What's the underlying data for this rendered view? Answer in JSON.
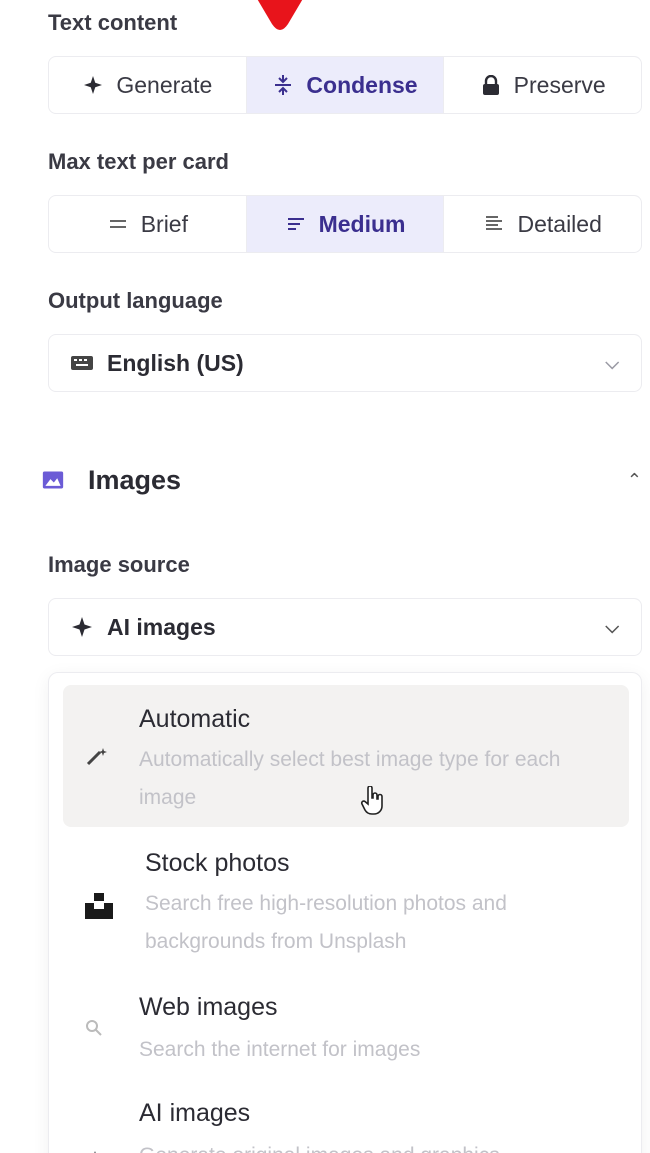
{
  "text_content": {
    "label": "Text content",
    "options": [
      {
        "label": "Generate",
        "icon": "sparkle-icon"
      },
      {
        "label": "Condense",
        "icon": "condense-icon",
        "active": true
      },
      {
        "label": "Preserve",
        "icon": "lock-icon"
      }
    ]
  },
  "max_text": {
    "label": "Max text per card",
    "options": [
      {
        "label": "Brief",
        "icon": "lines-brief-icon"
      },
      {
        "label": "Medium",
        "icon": "lines-medium-icon",
        "active": true
      },
      {
        "label": "Detailed",
        "icon": "lines-detailed-icon"
      }
    ]
  },
  "output_language": {
    "label": "Output language",
    "value": "English (US)",
    "icon": "keyboard-icon"
  },
  "images_section": {
    "title": "Images",
    "icon": "image-icon",
    "accent": "#6b5bd6"
  },
  "image_source": {
    "label": "Image source",
    "value": "AI images"
  },
  "menu": {
    "items": [
      {
        "title": "Automatic",
        "desc": "Automatically select best image type for each image",
        "icon": "magic-wand-icon"
      },
      {
        "title": "Stock photos",
        "desc": "Search free high-resolution photos and backgrounds from Unsplash",
        "icon": "unsplash-icon"
      },
      {
        "title": "Web images",
        "desc": "Search the internet for images",
        "icon": "search-icon"
      },
      {
        "title": "AI images",
        "desc": "Generate original images and graphics",
        "icon": "sparkle-icon"
      }
    ]
  }
}
